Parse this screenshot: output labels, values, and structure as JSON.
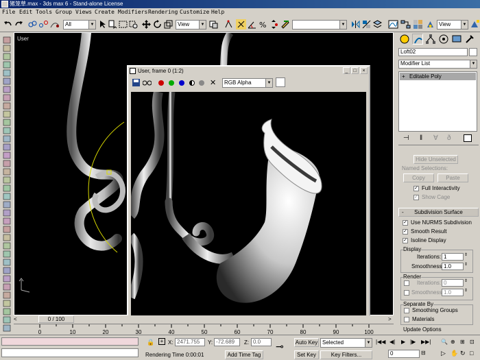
{
  "window": {
    "title": "猪笼草.max - 3ds max 6 - Stand-alone License"
  },
  "menu": [
    "File",
    "Edit",
    "Tools",
    "Group",
    "Views",
    "Create",
    "Modifiers",
    "Rendering",
    "Customize",
    "Help"
  ],
  "toolbar": {
    "selection_filter": "All",
    "ref_coord": "View",
    "named_sel": "",
    "ref_coord2": "View"
  },
  "viewport": {
    "label": "User"
  },
  "render_window": {
    "title": "User, frame 0 (1:2)",
    "channel": "RGB Alpha",
    "colors": {
      "red": "#cc0000",
      "green": "#00aa00",
      "blue": "#0000cc"
    }
  },
  "time_slider": {
    "label": "0 / 100"
  },
  "track_ticks": [
    "0",
    "10",
    "20",
    "30",
    "40",
    "50",
    "60",
    "70",
    "80",
    "90",
    "100"
  ],
  "command_panel": {
    "object_name": "Loft02",
    "modifier_list": "Modifier List",
    "stack_item": "Editable Poly",
    "hide_unselected": "Hide Unselected",
    "named_selections": "Named Selections:",
    "copy": "Copy",
    "paste": "Paste",
    "full_interactivity": "Full Interactivity",
    "show_cage": "Show Cage",
    "rollout_subdivision": "Subdivision Surface",
    "use_nurms": "Use NURMS Subdivision",
    "smooth_result": "Smooth Result",
    "isoline_display": "Isoline Display",
    "display_group": "Display",
    "iterations_label": "Iterations:",
    "iterations_value": "1",
    "smoothness_label": "Smoothness:",
    "smoothness_value": "1.0",
    "render_group": "Render",
    "r_iterations_label": "Iterations:",
    "r_iterations_value": "0",
    "r_smoothness_label": "Smoothness:",
    "r_smoothness_value": "1.0",
    "separate_by": "Separate By",
    "smoothing_groups": "Smoothing Groups",
    "materials": "Materials",
    "update_options": "Update Options"
  },
  "status": {
    "x_label": "X:",
    "x_value": "2471.755",
    "y_label": "Y:",
    "y_value": "-72.689",
    "z_label": "Z:",
    "z_value": "0.0",
    "rendering_time": "Rendering Time  0:00:01",
    "add_time_tag": "Add Time Tag",
    "auto_key": "Auto Key",
    "set_key": "Set Key",
    "key_mode": "Selected",
    "key_filters": "Key Filters...",
    "frame_value": "0"
  }
}
